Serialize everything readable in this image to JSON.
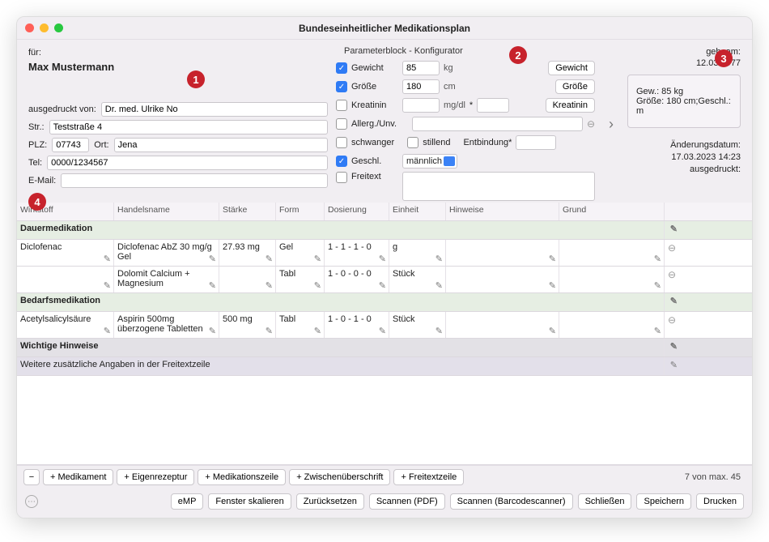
{
  "window": {
    "title": "Bundeseinheitlicher Medikationsplan"
  },
  "badges": [
    "1",
    "2",
    "3",
    "4"
  ],
  "patient": {
    "fuer_label": "für:",
    "name": "Max Mustermann",
    "printed_label": "ausgedruckt von:",
    "printed_by": "Dr. med. Ulrike No",
    "street_label": "Str.:",
    "street": "Teststraße 4",
    "plz_label": "PLZ:",
    "plz": "07743",
    "ort_label": "Ort:",
    "ort": "Jena",
    "tel_label": "Tel:",
    "tel": "0000/1234567",
    "email_label": "E-Mail:",
    "email": ""
  },
  "params": {
    "header": "Parameterblock - Konfigurator",
    "gewicht": {
      "label": "Gewicht",
      "value": "85",
      "unit": "kg",
      "btn": "Gewicht",
      "checked": true
    },
    "groesse": {
      "label": "Größe",
      "value": "180",
      "unit": "cm",
      "btn": "Größe",
      "checked": true
    },
    "kreatinin": {
      "label": "Kreatinin",
      "value": "",
      "unit": "mg/dl",
      "extra": "*",
      "btn": "Kreatinin",
      "checked": false
    },
    "allerg": {
      "label": "Allerg./Unv.",
      "value": "",
      "checked": false
    },
    "schwanger": {
      "label": "schwanger",
      "checked": false
    },
    "stillend": {
      "label": "stillend",
      "checked": false
    },
    "entbindung": {
      "label": "Entbindung*",
      "value": ""
    },
    "geschl": {
      "label": "Geschl.",
      "value": "männlich",
      "checked": true
    },
    "freitext": {
      "label": "Freitext",
      "checked": false
    }
  },
  "right": {
    "geb_label": "geb. am:",
    "geb_date": "12.03.1977",
    "summary_line1": "Gew.: 85 kg",
    "summary_line2": "Größe: 180 cm;Geschl.: m",
    "mod_label": "Änderungsdatum:",
    "mod_date": "17.03.2023 14:23",
    "printed_label": "ausgedruckt:"
  },
  "grid": {
    "cols": [
      "Wirkstoff",
      "Handelsname",
      "Stärke",
      "Form",
      "Dosierung",
      "Einheit",
      "Hinweise",
      "Grund"
    ],
    "sec_dauer": "Dauermedikation",
    "sec_bedarf": "Bedarfsmedikation",
    "sec_wichtig": "Wichtige Hinweise",
    "freitext_row": "Weitere zusätzliche Angaben in der Freitextzeile",
    "rows_dauer": [
      {
        "w": "Diclofenac",
        "h": "Diclofenac AbZ 30 mg/g Gel",
        "s": "27.93 mg",
        "f": "Gel",
        "d": "1 - 1 - 1 - 0",
        "e": "g",
        "hin": "",
        "g": ""
      },
      {
        "w": "",
        "h": "Dolomit Calcium + Magnesium",
        "s": "",
        "f": "Tabl",
        "d": "1 - 0 - 0 - 0",
        "e": "Stück",
        "hin": "",
        "g": ""
      }
    ],
    "rows_bedarf": [
      {
        "w": "Acetylsalicylsäure",
        "h": "Aspirin 500mg überzogene Tabletten",
        "s": "500 mg",
        "f": "Tabl",
        "d": "1 - 0 - 1 - 0",
        "e": "Stück",
        "hin": "",
        "g": ""
      }
    ]
  },
  "bottom": {
    "minus": "−",
    "medikament": "+ Medikament",
    "eigenrezeptur": "+ Eigenrezeptur",
    "medikationszeile": "+ Medikationszeile",
    "zwischen": "+ Zwischenüberschrift",
    "freitext": "+ Freitextzeile",
    "rowcount": "7 von max. 45"
  },
  "actions": {
    "emp": "eMP",
    "skalieren": "Fenster skalieren",
    "zurueck": "Zurücksetzen",
    "scanpdf": "Scannen (PDF)",
    "scanbc": "Scannen (Barcodescanner)",
    "schliessen": "Schließen",
    "speichern": "Speichern",
    "drucken": "Drucken"
  }
}
